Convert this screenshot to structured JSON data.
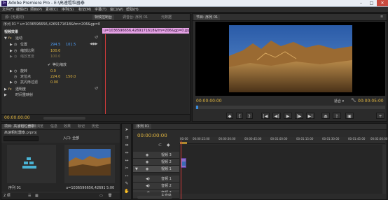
{
  "window": {
    "title": "Adobe Premiere Pro - E:\\高速粗粒器泰",
    "controls": [
      "–",
      "□",
      "✕"
    ]
  },
  "menu": [
    "文件(F)",
    "编辑(E)",
    "项目(P)",
    "素材(C)",
    "序列(S)",
    "标记(M)",
    "字幕(T)",
    "窗口(W)",
    "帮助(H)"
  ],
  "effect_controls": {
    "tabs": [
      "源: (无素材)",
      "特效控制台",
      "调音台: 序列 01",
      "元数据"
    ],
    "active_tab": 1,
    "sequence_path": "序列 01 * u=1036596656,4269171618&fm=206&gp=0.jpg",
    "clip_bar_label": "u=1036596656,4269171618&fm=206&gp=0.jpg",
    "section_video": "视频效果",
    "motion": "运动",
    "position_label": "位置",
    "position_x": "294.5",
    "position_y": "101.5",
    "scale_label": "缩放比例",
    "scale_value": "100.0",
    "scale_width_label": "缩放宽度",
    "scale_width_value": "100.0",
    "uniform_scale_label": "等比缩放",
    "rotation_label": "旋转",
    "rotation_value": "0.0",
    "anchor_label": "定位点",
    "anchor_x": "224.0",
    "anchor_y": "150.0",
    "antiflicker_label": "抗闪烁过滤",
    "antiflicker_value": "0.00",
    "opacity_label": "透明度",
    "time_remap_label": "时间重映射",
    "timecode": "00:00:00:00"
  },
  "program_monitor": {
    "title": "节目: 序列 01",
    "timecode_current": "00:00:00:00",
    "fit_label": "适合",
    "timecode_duration": "00:00:05:00"
  },
  "project": {
    "tabs": [
      "项目: 高速粗粒器泰",
      "媒体浏览",
      "信息",
      "效果",
      "标记",
      "历史"
    ],
    "project_name": "高速粗粒器泰.prproj",
    "search_placeholder": "",
    "in_label": "入口: 全部",
    "count_label": "2 项",
    "item1_label": "序列 01",
    "item2_label": "u=1036596656,4269171618&fm=...",
    "item2_duration": "5:00"
  },
  "timeline": {
    "tab": "序列 01",
    "timecode": "00:00:00:00",
    "ruler_ticks": [
      "00:00",
      "00:00:15:00",
      "00:00:30:00",
      "00:00:45:00",
      "00:01:00:00",
      "00:01:15:00",
      "00:01:30:00",
      "00:01:45:00",
      "00:02:00:00"
    ],
    "tracks": [
      "视频 3",
      "视频 2",
      "视频 1",
      "音频 1",
      "音频 2",
      "音频 3",
      "主音轨"
    ]
  }
}
